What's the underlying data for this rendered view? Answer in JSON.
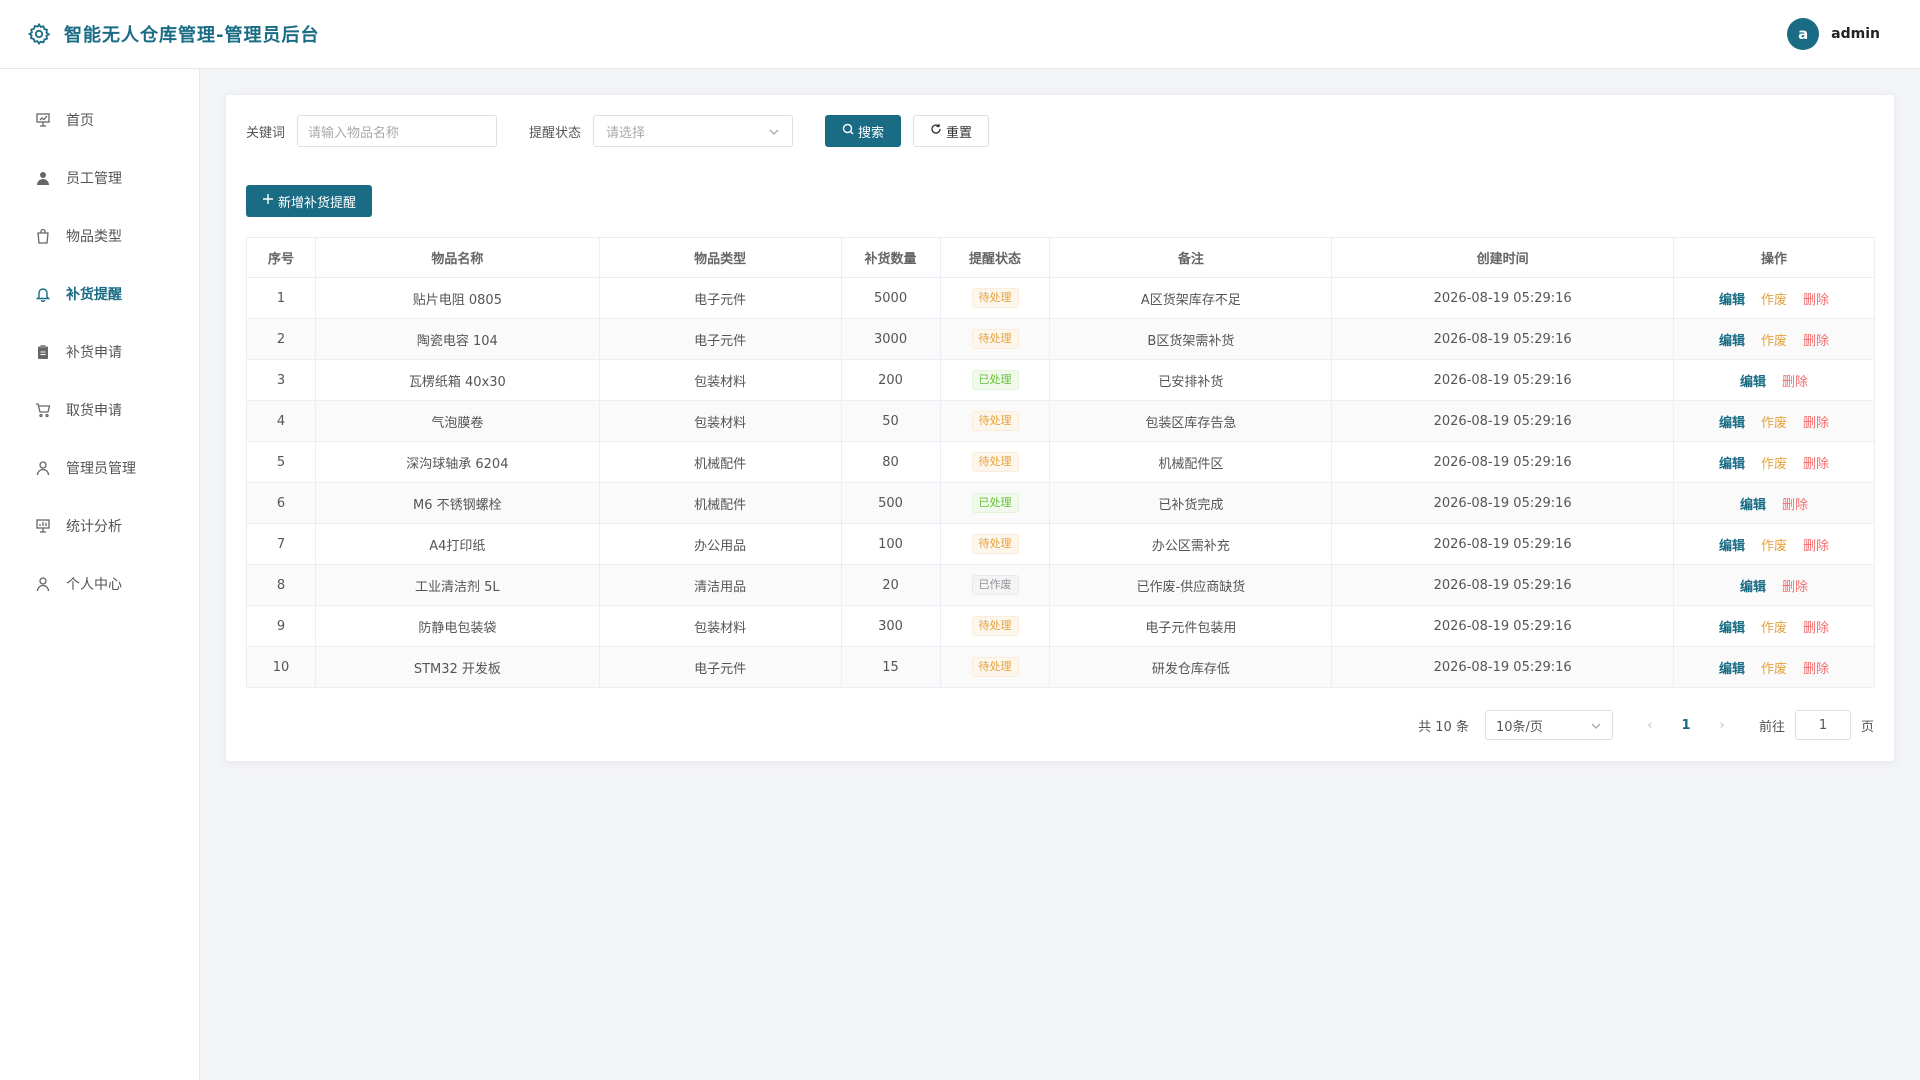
{
  "header": {
    "title": "智能无人仓库管理-管理员后台",
    "avatar_letter": "a",
    "username": "admin"
  },
  "sidebar": {
    "items": [
      {
        "label": "首页",
        "icon": "presentation-icon",
        "active": false
      },
      {
        "label": "员工管理",
        "icon": "user-solid-icon",
        "active": false
      },
      {
        "label": "物品类型",
        "icon": "shopping-bag-icon",
        "active": false
      },
      {
        "label": "补货提醒",
        "icon": "bell-icon",
        "active": true
      },
      {
        "label": "补货申请",
        "icon": "clipboard-icon",
        "active": false
      },
      {
        "label": "取货申请",
        "icon": "cart-icon",
        "active": false
      },
      {
        "label": "管理员管理",
        "icon": "user-icon",
        "active": false
      },
      {
        "label": "统计分析",
        "icon": "chart-board-icon",
        "active": false
      },
      {
        "label": "个人中心",
        "icon": "user-icon",
        "active": false
      }
    ]
  },
  "filter": {
    "keyword_label": "关键词",
    "keyword_placeholder": "请输入物品名称",
    "status_label": "提醒状态",
    "status_placeholder": "请选择",
    "search_label": "搜索",
    "reset_label": "重置"
  },
  "add_button": "新增补货提醒",
  "table": {
    "columns": [
      "序号",
      "物品名称",
      "物品类型",
      "补货数量",
      "提醒状态",
      "备注",
      "创建时间",
      "操作"
    ],
    "rows": [
      {
        "no": "1",
        "name": "贴片电阻 0805",
        "type": "电子元件",
        "qty": "5000",
        "status": "待处理",
        "status_kind": "pending",
        "note": "A区货架库存不足",
        "time": "2026-08-19 05:29:16"
      },
      {
        "no": "2",
        "name": "陶瓷电容 104",
        "type": "电子元件",
        "qty": "3000",
        "status": "待处理",
        "status_kind": "pending",
        "note": "B区货架需补货",
        "time": "2026-08-19 05:29:16"
      },
      {
        "no": "3",
        "name": "瓦楞纸箱 40x30",
        "type": "包装材料",
        "qty": "200",
        "status": "已处理",
        "status_kind": "done",
        "note": "已安排补货",
        "time": "2026-08-19 05:29:16"
      },
      {
        "no": "4",
        "name": "气泡膜卷",
        "type": "包装材料",
        "qty": "50",
        "status": "待处理",
        "status_kind": "pending",
        "note": "包装区库存告急",
        "time": "2026-08-19 05:29:16"
      },
      {
        "no": "5",
        "name": "深沟球轴承 6204",
        "type": "机械配件",
        "qty": "80",
        "status": "待处理",
        "status_kind": "pending",
        "note": "机械配件区",
        "time": "2026-08-19 05:29:16"
      },
      {
        "no": "6",
        "name": "M6 不锈钢螺栓",
        "type": "机械配件",
        "qty": "500",
        "status": "已处理",
        "status_kind": "done",
        "note": "已补货完成",
        "time": "2026-08-19 05:29:16"
      },
      {
        "no": "7",
        "name": "A4打印纸",
        "type": "办公用品",
        "qty": "100",
        "status": "待处理",
        "status_kind": "pending",
        "note": "办公区需补充",
        "time": "2026-08-19 05:29:16"
      },
      {
        "no": "8",
        "name": "工业清洁剂 5L",
        "type": "清洁用品",
        "qty": "20",
        "status": "已作废",
        "status_kind": "void",
        "note": "已作废-供应商缺货",
        "time": "2026-08-19 05:29:16"
      },
      {
        "no": "9",
        "name": "防静电包装袋",
        "type": "包装材料",
        "qty": "300",
        "status": "待处理",
        "status_kind": "pending",
        "note": "电子元件包装用",
        "time": "2026-08-19 05:29:16"
      },
      {
        "no": "10",
        "name": "STM32 开发板",
        "type": "电子元件",
        "qty": "15",
        "status": "待处理",
        "status_kind": "pending",
        "note": "研发仓库存低",
        "time": "2026-08-19 05:29:16"
      }
    ],
    "op_edit": "编辑",
    "op_void": "作废",
    "op_delete": "删除"
  },
  "pagination": {
    "total_text": "共 10 条",
    "page_size": "10条/页",
    "current_page": "1",
    "goto_label": "前往",
    "goto_value": "1",
    "page_suffix": "页"
  },
  "colors": {
    "primary": "#1a6c85",
    "pending": "#e6a23c",
    "done": "#67c23a",
    "void": "#909399",
    "danger": "#f56c6c"
  }
}
